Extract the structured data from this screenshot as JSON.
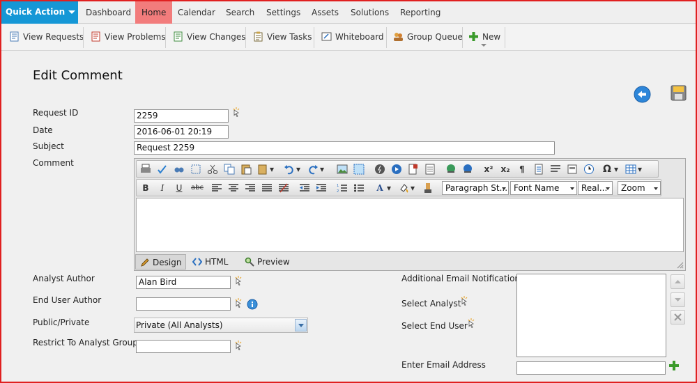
{
  "nav": {
    "quick_action": "Quick Action",
    "tabs": [
      "Dashboard",
      "Home",
      "Calendar",
      "Search",
      "Settings",
      "Assets",
      "Solutions",
      "Reporting"
    ],
    "active_tab": "Home"
  },
  "toolbar": {
    "items": [
      "View Requests",
      "View Problems",
      "View Changes",
      "View Tasks",
      "Whiteboard",
      "Group Queue",
      "New"
    ]
  },
  "page": {
    "title": "Edit Comment"
  },
  "form": {
    "request_id_label": "Request ID",
    "request_id_value": "2259",
    "date_label": "Date",
    "date_value": "2016-06-01 20:19",
    "subject_label": "Subject",
    "subject_value": "Request 2259",
    "comment_label": "Comment",
    "analyst_author_label": "Analyst Author",
    "analyst_author_value": "Alan Bird",
    "end_user_author_label": "End User Author",
    "end_user_author_value": "",
    "public_private_label": "Public/Private",
    "public_private_value": "Private (All Analysts)",
    "restrict_group_label": "Restrict To Analyst Group",
    "restrict_group_value": "",
    "additional_email_label": "Additional Email Notification:",
    "select_analyst_label": "Select Analyst",
    "select_end_user_label": "Select End User",
    "enter_email_label": "Enter Email Address",
    "enter_email_value": ""
  },
  "editor": {
    "paragraph_style": "Paragraph St...",
    "font_name": "Font Name",
    "font_size": "Real...",
    "zoom": "Zoom",
    "modes": [
      "Design",
      "HTML",
      "Preview"
    ],
    "active_mode": "Design",
    "format_glyphs": {
      "bold": "B",
      "italic": "I",
      "underline": "U",
      "strike": "abc",
      "font_color": "A",
      "symbol": "Ω"
    }
  },
  "colors": {
    "quick_action_bg": "#1597d6",
    "active_tab_bg": "#f27c7c",
    "frame_border": "#e02020",
    "page_bg": "#f0f0f0"
  }
}
